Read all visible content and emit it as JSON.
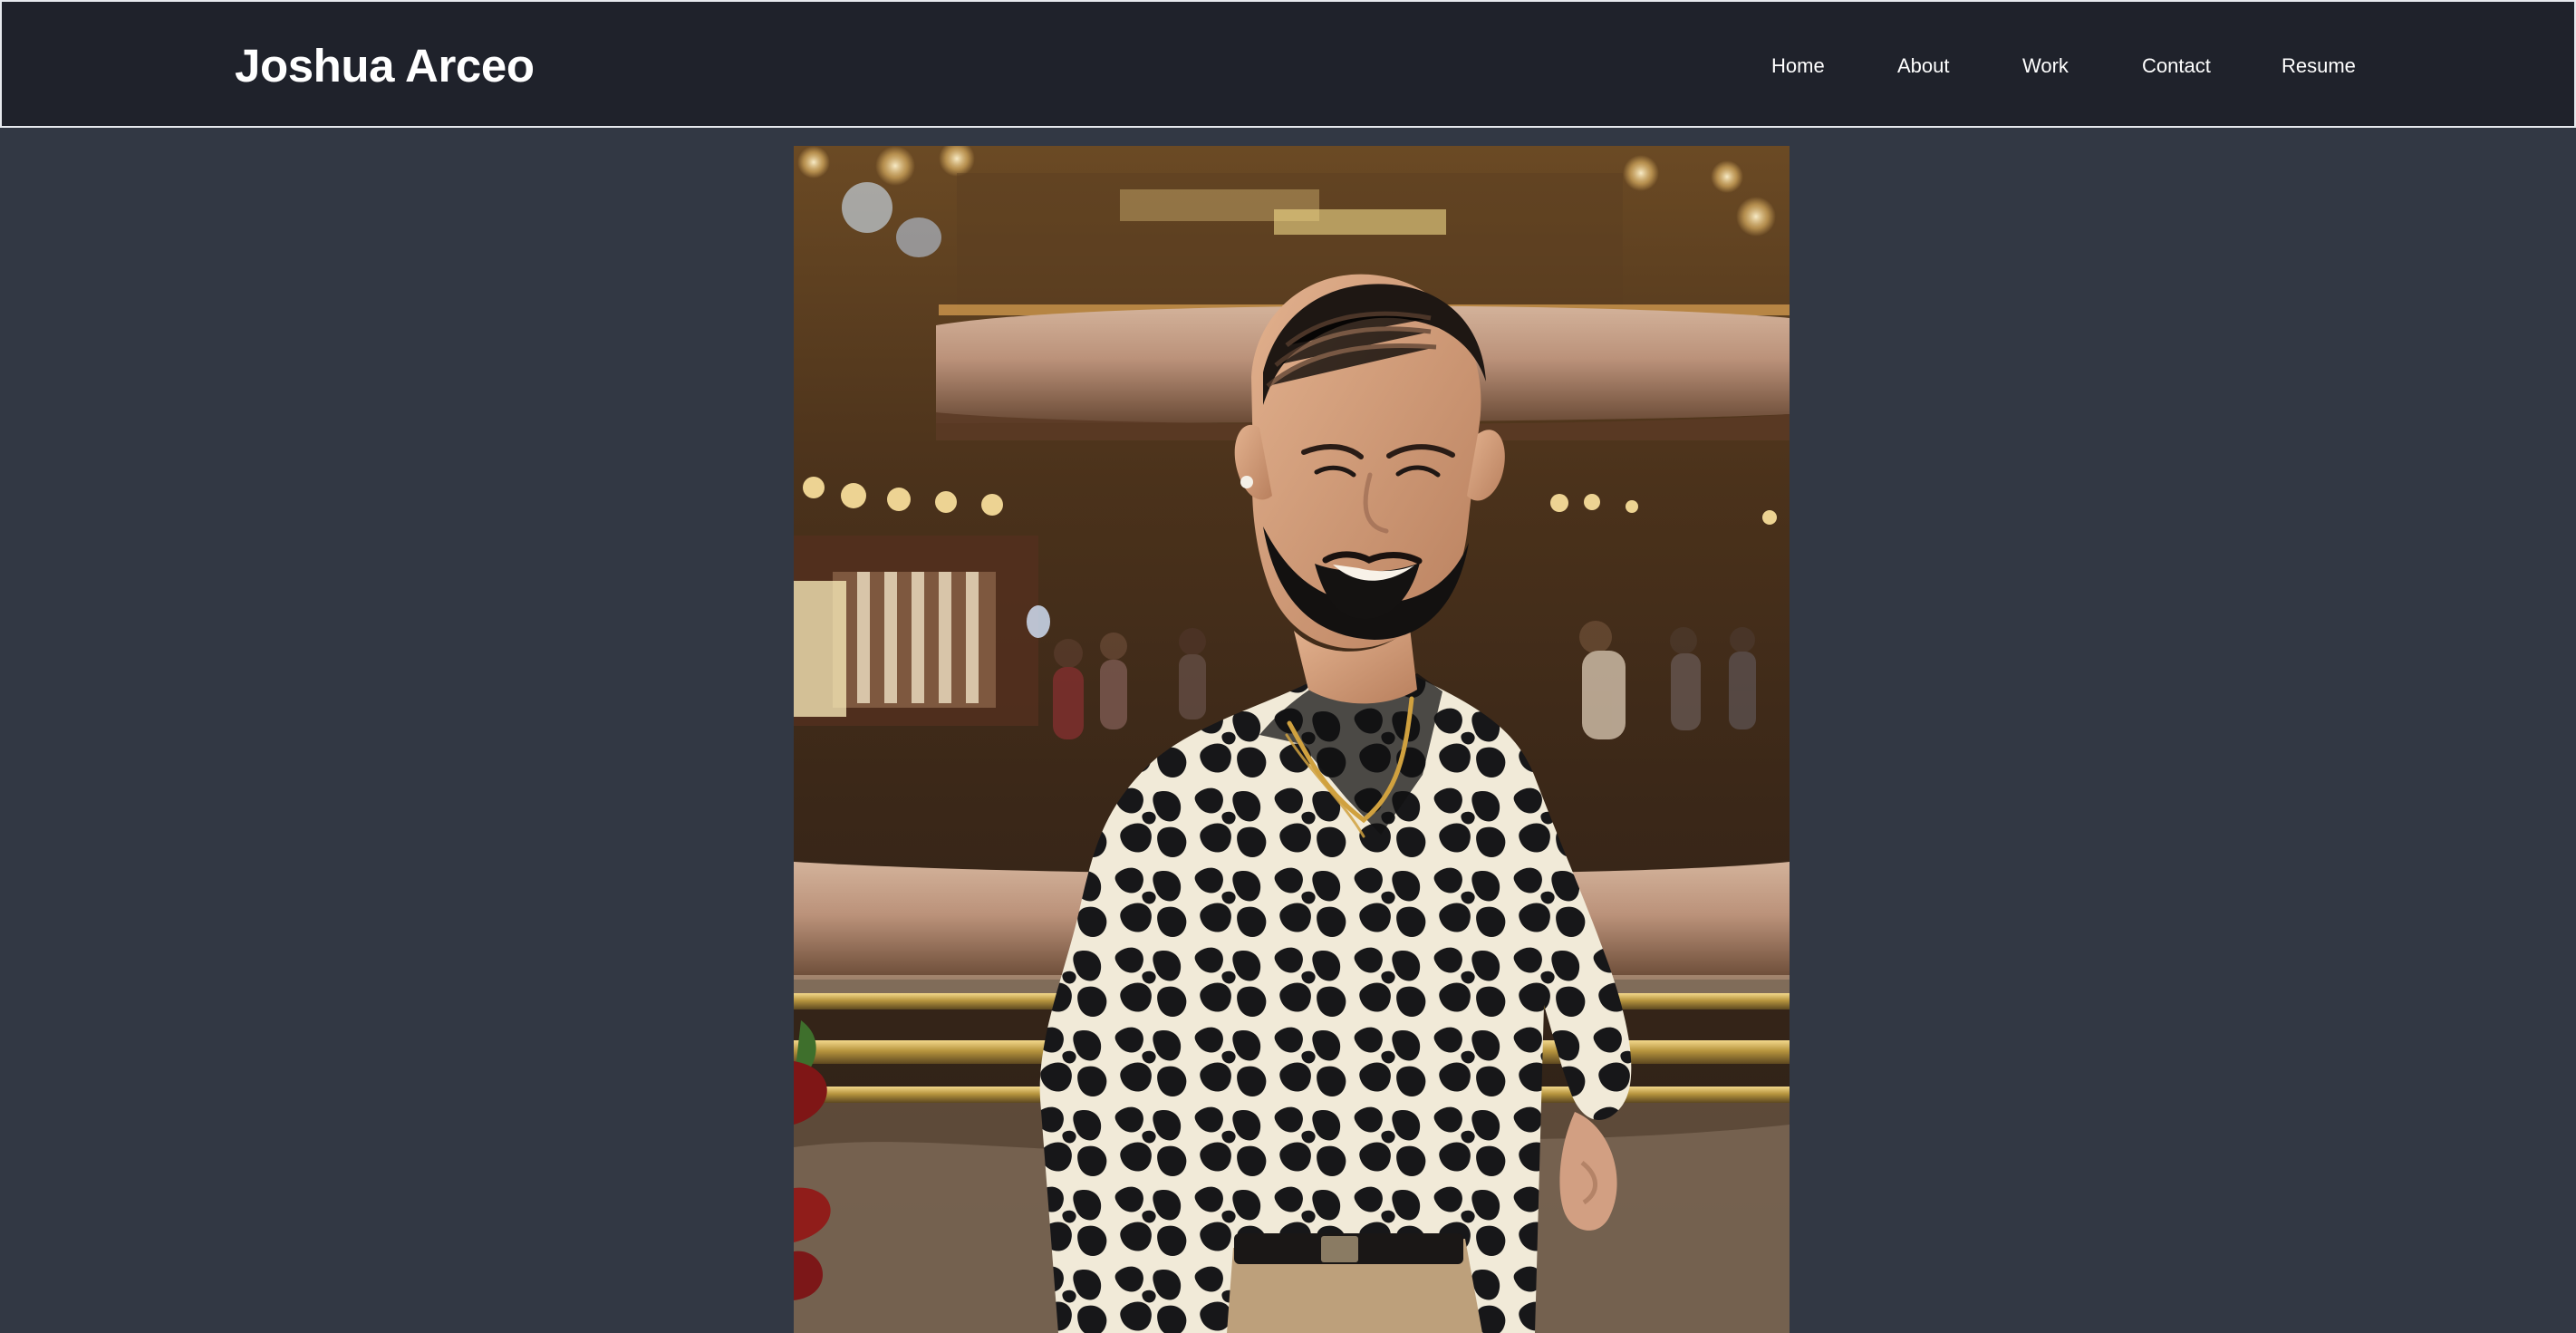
{
  "header": {
    "brand": "Joshua Arceo",
    "nav": [
      {
        "label": "Home"
      },
      {
        "label": "About"
      },
      {
        "label": "Work"
      },
      {
        "label": "Contact"
      },
      {
        "label": "Resume"
      }
    ]
  },
  "hero": {
    "image_alt": "Joshua Arceo"
  },
  "colors": {
    "page_background": "#323844",
    "header_background": "#1f222b",
    "header_border": "#e6e9ee",
    "text": "#ffffff"
  }
}
